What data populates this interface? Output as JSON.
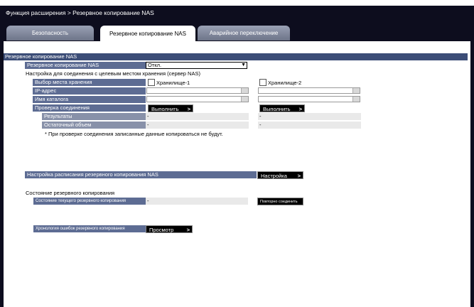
{
  "breadcrumb": "Функция расширения > Резервное копирование NAS",
  "tabs": [
    "Безопасность",
    "Резервное копирование NAS",
    "Аварийное переключение"
  ],
  "section_title": "Резервное копирование NAS",
  "nas_backup": {
    "label": "Резервное копирование NAS",
    "value": "Откл."
  },
  "conn_heading": "Настройка для соединения с целевым местом хранения (сервер NAS)",
  "storage_select_label": "Выбор места хранения",
  "storage1": "Хранилище-1",
  "storage2": "Хранилище-2",
  "ip_label": "IP-адрес",
  "dir_label": "Имя каталога",
  "check_label": "Проверка соединения",
  "run_button": "Выполнить",
  "results_label": "Результаты",
  "results_values": [
    "-",
    "-"
  ],
  "remaining_label": "Остаточный объем",
  "remaining_values": [
    "-",
    "-"
  ],
  "note": "* При проверке соединения записанные данные копироваться не будут.",
  "schedule_label": "Настройка расписания резервного копирования NAS",
  "setup_button": "Настройка",
  "status_heading": "Состояние резервного копирования",
  "current_status_label": "Состояние текущего резервного копирования",
  "current_status_value": "-",
  "reconnect_button": "Повторно соединить",
  "error_log_label": "Хронология ошибок резервного копирования",
  "view_button": "Просмотр"
}
